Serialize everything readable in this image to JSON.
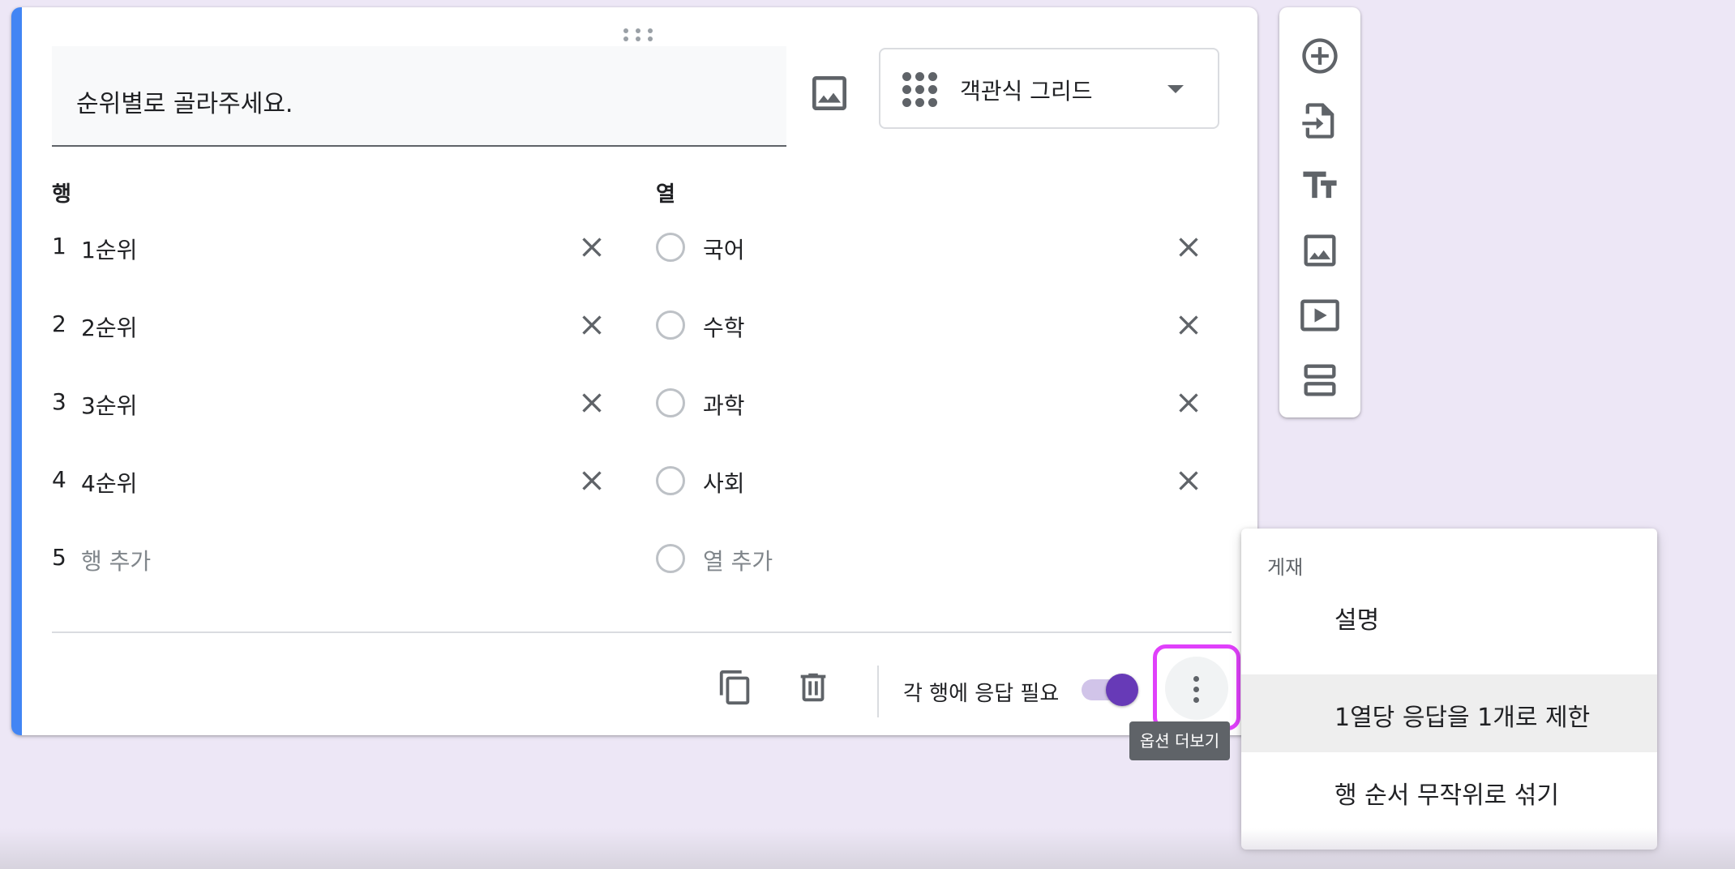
{
  "question": {
    "title": "순위별로 골라주세요.",
    "type": "객관식 그리드"
  },
  "rows": {
    "header": "행",
    "items": [
      {
        "num": "1",
        "label": "1순위"
      },
      {
        "num": "2",
        "label": "2순위"
      },
      {
        "num": "3",
        "label": "3순위"
      },
      {
        "num": "4",
        "label": "4순위"
      }
    ],
    "add": {
      "num": "5",
      "label": "행 추가"
    }
  },
  "columns": {
    "header": "열",
    "items": [
      {
        "label": "국어"
      },
      {
        "label": "수학"
      },
      {
        "label": "과학"
      },
      {
        "label": "사회"
      }
    ],
    "add": {
      "label": "열 추가"
    }
  },
  "footer": {
    "required_label": "각 행에 응답 필요",
    "required_on": true,
    "more_tooltip": "옵션 더보기"
  },
  "menu": {
    "section_label": "게재",
    "items": [
      {
        "label": "설명"
      },
      {
        "label": "1열당 응답을 1개로 제한"
      },
      {
        "label": "행 순서 무작위로 섞기"
      }
    ]
  },
  "toolbar": {
    "icons": [
      "add-question-icon",
      "import-questions-icon",
      "add-title-icon",
      "add-image-icon",
      "add-video-icon",
      "add-section-icon"
    ]
  },
  "colors": {
    "accent": "#4285f4",
    "toggle": "#673ab7",
    "highlight": "#e040fb",
    "background": "#ede7f6"
  }
}
